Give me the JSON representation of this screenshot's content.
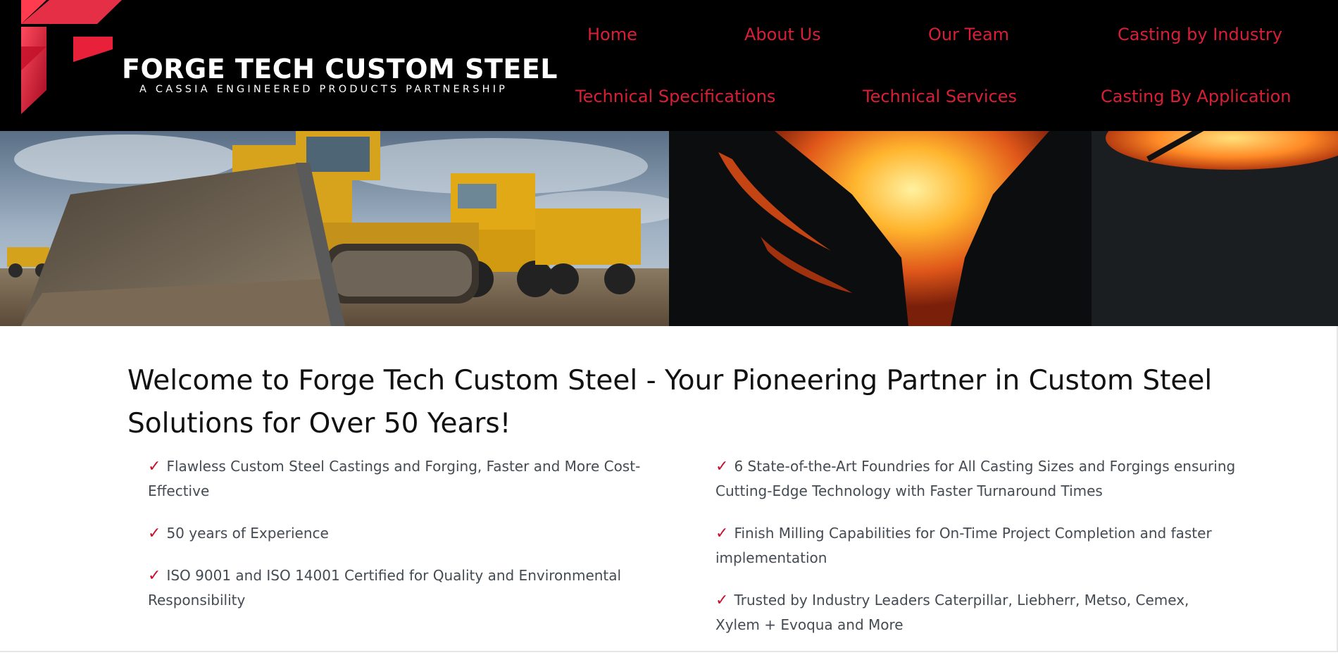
{
  "brand": {
    "name": "FORGE TECH CUSTOM STEEL",
    "tagline": "A CASSIA ENGINEERED PRODUCTS PARTNERSHIP"
  },
  "nav": {
    "home": "Home",
    "about": "About Us",
    "team": "Our Team",
    "casting_industry": "Casting by Industry",
    "tech_specs": "Technical Specifications",
    "tech_services": "Technical Services",
    "casting_application": "Casting By Application"
  },
  "colors": {
    "accent": "#d81f36",
    "header_bg": "#000000",
    "text": "#444b52"
  },
  "hero": {
    "heading": "Welcome to Forge Tech Custom Steel - Your Pioneering Partner in Custom Steel Solutions for Over 50 Years!"
  },
  "features": {
    "check_icon": "✓",
    "left": [
      "Flawless Custom Steel Castings and Forging, Faster and More Cost-Effective",
      "50 years of Experience",
      "ISO 9001 and ISO 14001 Certified for Quality and Environmental Responsibility"
    ],
    "right": [
      "6 State-of-the-Art Foundries for All Casting Sizes and Forgings ensuring Cutting-Edge Technology with Faster Turnaround Times",
      "Finish Milling Capabilities for On-Time Project Completion and faster implementation",
      "Trusted by Industry Leaders Caterpillar, Liebherr, Metso, Cemex, Xylem + Evoqua and More"
    ]
  }
}
